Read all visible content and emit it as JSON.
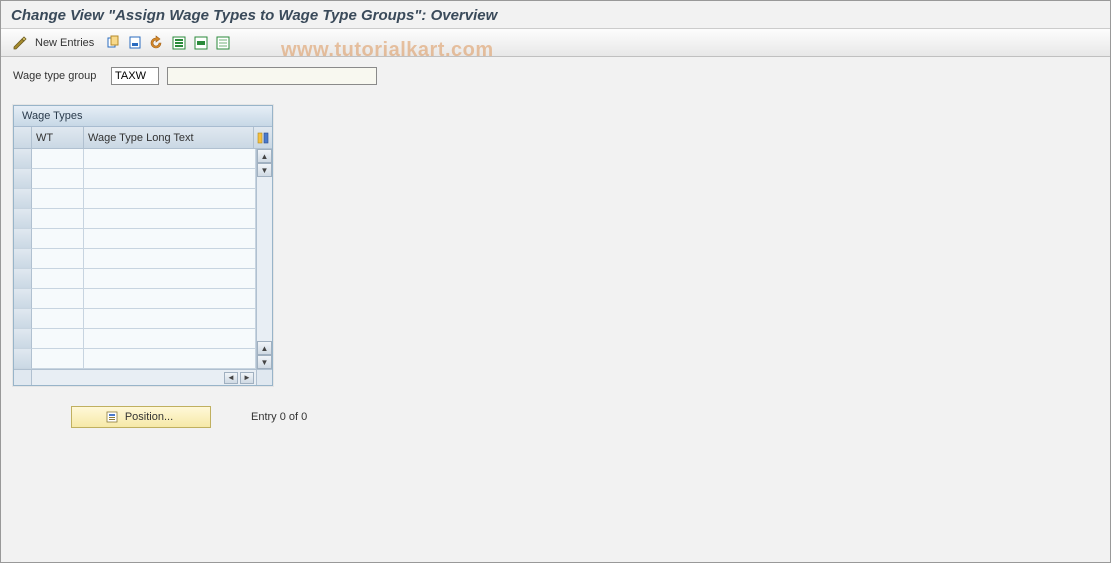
{
  "header": {
    "title": "Change View \"Assign Wage Types to Wage Type Groups\": Overview"
  },
  "toolbar": {
    "new_entries_label": "New Entries",
    "icons": {
      "toggle": "toggle-display-change",
      "copy": "copy",
      "delete": "delete",
      "undo": "undo",
      "select_all": "select-all",
      "select_block": "select-block",
      "deselect": "deselect-all"
    }
  },
  "form": {
    "wage_type_group_label": "Wage type group",
    "wage_type_group_value": "TAXW",
    "wage_type_group_desc": ""
  },
  "panel": {
    "title": "Wage Types",
    "columns": {
      "wt": "WT",
      "long_text": "Wage Type Long Text"
    },
    "rows": [
      {
        "wt": "",
        "long_text": ""
      },
      {
        "wt": "",
        "long_text": ""
      },
      {
        "wt": "",
        "long_text": ""
      },
      {
        "wt": "",
        "long_text": ""
      },
      {
        "wt": "",
        "long_text": ""
      },
      {
        "wt": "",
        "long_text": ""
      },
      {
        "wt": "",
        "long_text": ""
      },
      {
        "wt": "",
        "long_text": ""
      },
      {
        "wt": "",
        "long_text": ""
      },
      {
        "wt": "",
        "long_text": ""
      },
      {
        "wt": "",
        "long_text": ""
      }
    ]
  },
  "footer": {
    "position_label": "Position...",
    "entry_text": "Entry 0 of 0"
  },
  "watermark": "www.tutorialkart.com"
}
